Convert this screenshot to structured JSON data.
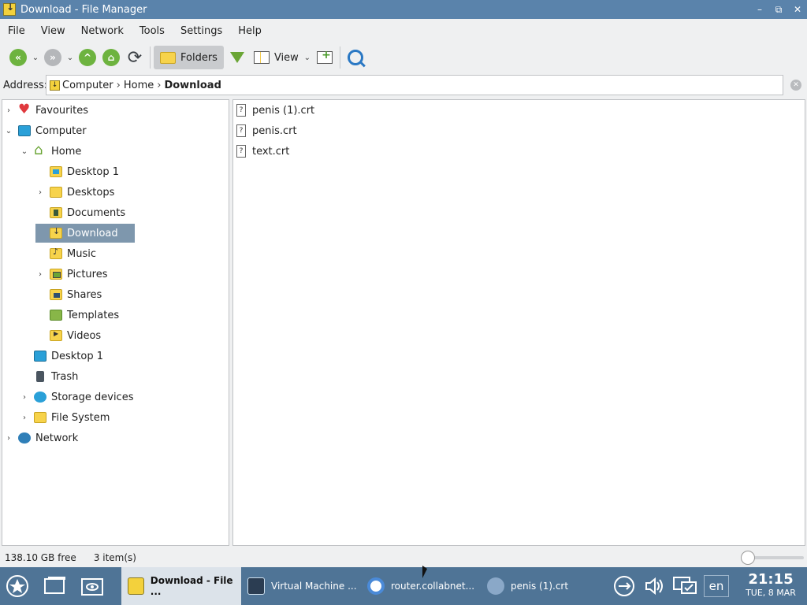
{
  "window": {
    "title": "Download - File Manager",
    "controls": [
      "–",
      "⧉",
      "✕"
    ]
  },
  "menubar": {
    "items": [
      "File",
      "View",
      "Network",
      "Tools",
      "Settings",
      "Help"
    ]
  },
  "toolbar": {
    "folders_label": "Folders",
    "view_label": "View"
  },
  "address": {
    "label": "Address:",
    "crumbs": [
      "Computer",
      "Home",
      "Download"
    ]
  },
  "tree": {
    "favourites": "Favourites",
    "computer": "Computer",
    "home": "Home",
    "desktop1_home": "Desktop 1",
    "desktops": "Desktops",
    "documents": "Documents",
    "download": "Download",
    "music": "Music",
    "pictures": "Pictures",
    "shares": "Shares",
    "templates": "Templates",
    "videos": "Videos",
    "desktop1": "Desktop 1",
    "trash": "Trash",
    "storage": "Storage devices",
    "filesystem": "File System",
    "network": "Network"
  },
  "files": [
    {
      "name": "penis (1).crt"
    },
    {
      "name": "penis.crt"
    },
    {
      "name": "text.crt"
    }
  ],
  "status": {
    "free": "138.10 GB free",
    "count": "3 item(s)"
  },
  "taskbar": {
    "tasks": [
      {
        "label": "Download - File ..."
      },
      {
        "label": "Virtual Machine ..."
      },
      {
        "label": "router.collabnet..."
      },
      {
        "label": "penis (1).crt"
      }
    ],
    "lang": "en",
    "time": "21:15",
    "date": "TUE, 8 MAR"
  }
}
